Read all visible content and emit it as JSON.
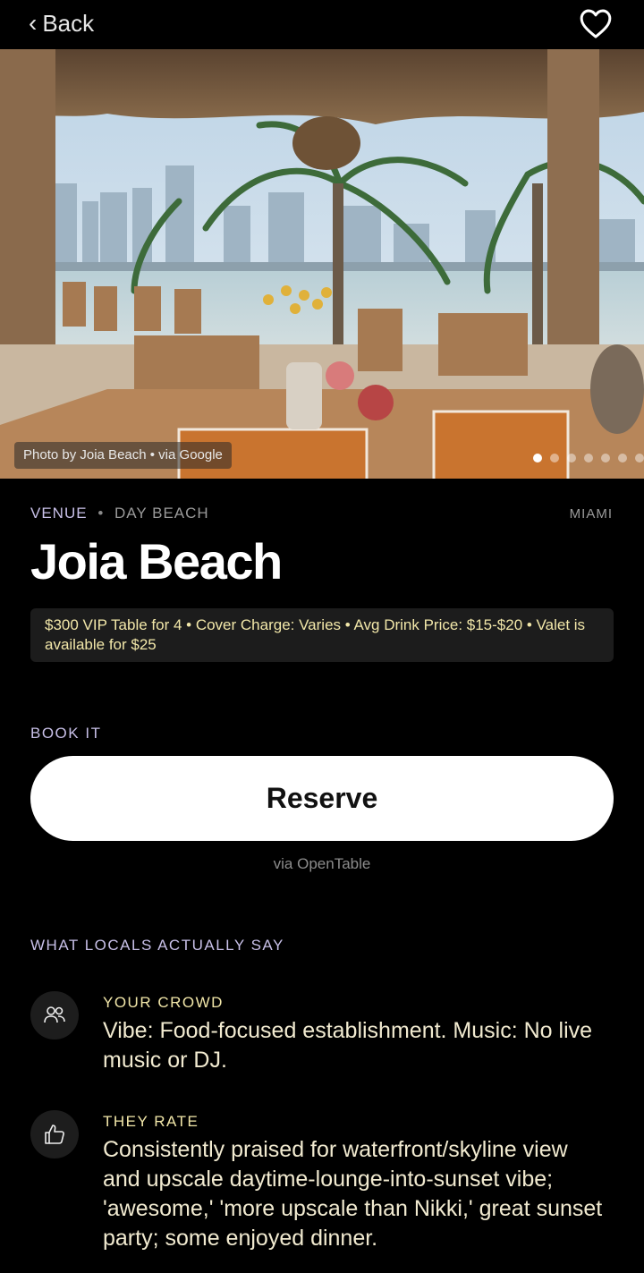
{
  "nav": {
    "back_chevron": "‹",
    "back_label": "Back",
    "favorite_icon": "heart-outline-icon"
  },
  "hero": {
    "credit": "Photo by Joia Beach • via Google",
    "dots_total": 7,
    "dots_active_index": 0
  },
  "venue": {
    "type": "VENUE",
    "separator": "•",
    "category": "DAY BEACH",
    "city": "MIAMI",
    "name": "Joia Beach",
    "info": "$300 VIP Table for 4 • Cover Charge: Varies • Avg Drink Price: $15-$20 • Valet is available for $25"
  },
  "booking": {
    "section_label": "BOOK IT",
    "button_label": "Reserve",
    "provider": "via OpenTable"
  },
  "reviews": {
    "section_label": "WHAT LOCALS ACTUALLY SAY",
    "items": [
      {
        "icon": "people-icon",
        "heading": "YOUR CROWD",
        "text": "Vibe: Food-focused establishment. Music: No live music or DJ."
      },
      {
        "icon": "thumbs-up-icon",
        "heading": "THEY RATE",
        "text": "Consistently praised for waterfront/skyline view and upscale daytime-lounge-into-sunset vibe; 'awesome,' 'more upscale than Nikki,' great sunset party; some enjoyed dinner."
      }
    ]
  },
  "colors": {
    "background": "#000000",
    "accent_lavender": "#c8c0e8",
    "accent_cream": "#f2e7a9",
    "button_bg": "#ffffff"
  }
}
